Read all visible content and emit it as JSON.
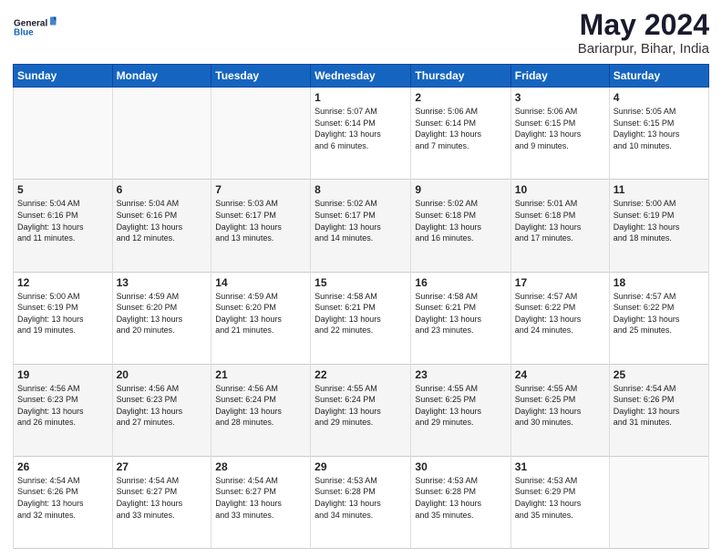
{
  "logo": {
    "line1": "General",
    "line2": "Blue"
  },
  "title": "May 2024",
  "location": "Bariarpur, Bihar, India",
  "days_of_week": [
    "Sunday",
    "Monday",
    "Tuesday",
    "Wednesday",
    "Thursday",
    "Friday",
    "Saturday"
  ],
  "weeks": [
    [
      {
        "day": "",
        "info": ""
      },
      {
        "day": "",
        "info": ""
      },
      {
        "day": "",
        "info": ""
      },
      {
        "day": "1",
        "info": "Sunrise: 5:07 AM\nSunset: 6:14 PM\nDaylight: 13 hours\nand 6 minutes."
      },
      {
        "day": "2",
        "info": "Sunrise: 5:06 AM\nSunset: 6:14 PM\nDaylight: 13 hours\nand 7 minutes."
      },
      {
        "day": "3",
        "info": "Sunrise: 5:06 AM\nSunset: 6:15 PM\nDaylight: 13 hours\nand 9 minutes."
      },
      {
        "day": "4",
        "info": "Sunrise: 5:05 AM\nSunset: 6:15 PM\nDaylight: 13 hours\nand 10 minutes."
      }
    ],
    [
      {
        "day": "5",
        "info": "Sunrise: 5:04 AM\nSunset: 6:16 PM\nDaylight: 13 hours\nand 11 minutes."
      },
      {
        "day": "6",
        "info": "Sunrise: 5:04 AM\nSunset: 6:16 PM\nDaylight: 13 hours\nand 12 minutes."
      },
      {
        "day": "7",
        "info": "Sunrise: 5:03 AM\nSunset: 6:17 PM\nDaylight: 13 hours\nand 13 minutes."
      },
      {
        "day": "8",
        "info": "Sunrise: 5:02 AM\nSunset: 6:17 PM\nDaylight: 13 hours\nand 14 minutes."
      },
      {
        "day": "9",
        "info": "Sunrise: 5:02 AM\nSunset: 6:18 PM\nDaylight: 13 hours\nand 16 minutes."
      },
      {
        "day": "10",
        "info": "Sunrise: 5:01 AM\nSunset: 6:18 PM\nDaylight: 13 hours\nand 17 minutes."
      },
      {
        "day": "11",
        "info": "Sunrise: 5:00 AM\nSunset: 6:19 PM\nDaylight: 13 hours\nand 18 minutes."
      }
    ],
    [
      {
        "day": "12",
        "info": "Sunrise: 5:00 AM\nSunset: 6:19 PM\nDaylight: 13 hours\nand 19 minutes."
      },
      {
        "day": "13",
        "info": "Sunrise: 4:59 AM\nSunset: 6:20 PM\nDaylight: 13 hours\nand 20 minutes."
      },
      {
        "day": "14",
        "info": "Sunrise: 4:59 AM\nSunset: 6:20 PM\nDaylight: 13 hours\nand 21 minutes."
      },
      {
        "day": "15",
        "info": "Sunrise: 4:58 AM\nSunset: 6:21 PM\nDaylight: 13 hours\nand 22 minutes."
      },
      {
        "day": "16",
        "info": "Sunrise: 4:58 AM\nSunset: 6:21 PM\nDaylight: 13 hours\nand 23 minutes."
      },
      {
        "day": "17",
        "info": "Sunrise: 4:57 AM\nSunset: 6:22 PM\nDaylight: 13 hours\nand 24 minutes."
      },
      {
        "day": "18",
        "info": "Sunrise: 4:57 AM\nSunset: 6:22 PM\nDaylight: 13 hours\nand 25 minutes."
      }
    ],
    [
      {
        "day": "19",
        "info": "Sunrise: 4:56 AM\nSunset: 6:23 PM\nDaylight: 13 hours\nand 26 minutes."
      },
      {
        "day": "20",
        "info": "Sunrise: 4:56 AM\nSunset: 6:23 PM\nDaylight: 13 hours\nand 27 minutes."
      },
      {
        "day": "21",
        "info": "Sunrise: 4:56 AM\nSunset: 6:24 PM\nDaylight: 13 hours\nand 28 minutes."
      },
      {
        "day": "22",
        "info": "Sunrise: 4:55 AM\nSunset: 6:24 PM\nDaylight: 13 hours\nand 29 minutes."
      },
      {
        "day": "23",
        "info": "Sunrise: 4:55 AM\nSunset: 6:25 PM\nDaylight: 13 hours\nand 29 minutes."
      },
      {
        "day": "24",
        "info": "Sunrise: 4:55 AM\nSunset: 6:25 PM\nDaylight: 13 hours\nand 30 minutes."
      },
      {
        "day": "25",
        "info": "Sunrise: 4:54 AM\nSunset: 6:26 PM\nDaylight: 13 hours\nand 31 minutes."
      }
    ],
    [
      {
        "day": "26",
        "info": "Sunrise: 4:54 AM\nSunset: 6:26 PM\nDaylight: 13 hours\nand 32 minutes."
      },
      {
        "day": "27",
        "info": "Sunrise: 4:54 AM\nSunset: 6:27 PM\nDaylight: 13 hours\nand 33 minutes."
      },
      {
        "day": "28",
        "info": "Sunrise: 4:54 AM\nSunset: 6:27 PM\nDaylight: 13 hours\nand 33 minutes."
      },
      {
        "day": "29",
        "info": "Sunrise: 4:53 AM\nSunset: 6:28 PM\nDaylight: 13 hours\nand 34 minutes."
      },
      {
        "day": "30",
        "info": "Sunrise: 4:53 AM\nSunset: 6:28 PM\nDaylight: 13 hours\nand 35 minutes."
      },
      {
        "day": "31",
        "info": "Sunrise: 4:53 AM\nSunset: 6:29 PM\nDaylight: 13 hours\nand 35 minutes."
      },
      {
        "day": "",
        "info": ""
      }
    ]
  ]
}
